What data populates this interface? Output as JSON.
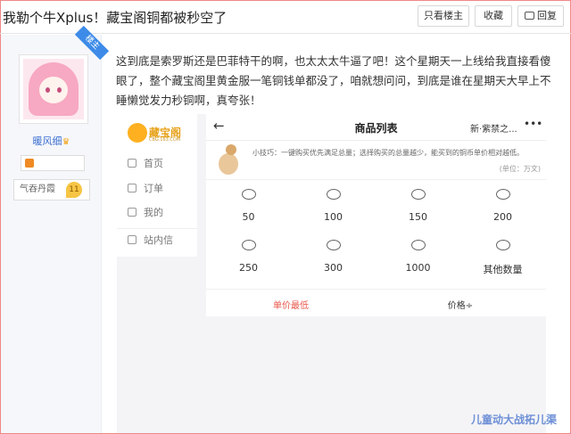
{
  "page": {
    "title": "我勒个牛Xplus！藏宝阁铜都被秒空了",
    "buttons": {
      "only_op": "只看楼主",
      "favorite": "收藏",
      "reply": "回复"
    }
  },
  "author": {
    "badge": "楼主",
    "name": "暖风细",
    "level_label": "气吞丹霞",
    "level_num": "11"
  },
  "post": {
    "text": "这到底是索罗斯还是巴菲特干的啊，也太太太牛逼了吧！这个星期天一上线给我直接看傻眼了，整个藏宝阁里黄金服一笔铜钱单都没了，咱就想问问，到底是谁在星期天大早上不睡懒觉发力秒铜啊，真夸张！"
  },
  "screenshot": {
    "logo_text": "藏宝阁",
    "logo_sub": "CBG.163.COM",
    "nav": [
      "首页",
      "订单",
      "我的",
      "站内信"
    ],
    "header": {
      "title": "商品列表",
      "server": "新·紫禁之...",
      "more": "•••"
    },
    "tip": "小技巧：一键购买优先满足总量；选择购买的总量越少，能买到的铜币单价相对越低。",
    "unit": "(单位：万文)",
    "amounts": [
      "50",
      "100",
      "150",
      "200",
      "250",
      "300",
      "1000",
      "其他数量"
    ],
    "sort": {
      "lowest": "单价最低",
      "price": "价格÷"
    }
  },
  "watermark": "儿童动大战拓儿渠",
  "colors": {
    "accent_blue": "#3d8be8",
    "link_blue": "#3b6fd0",
    "sort_red": "#e8564a",
    "gold": "#f3a51b"
  }
}
